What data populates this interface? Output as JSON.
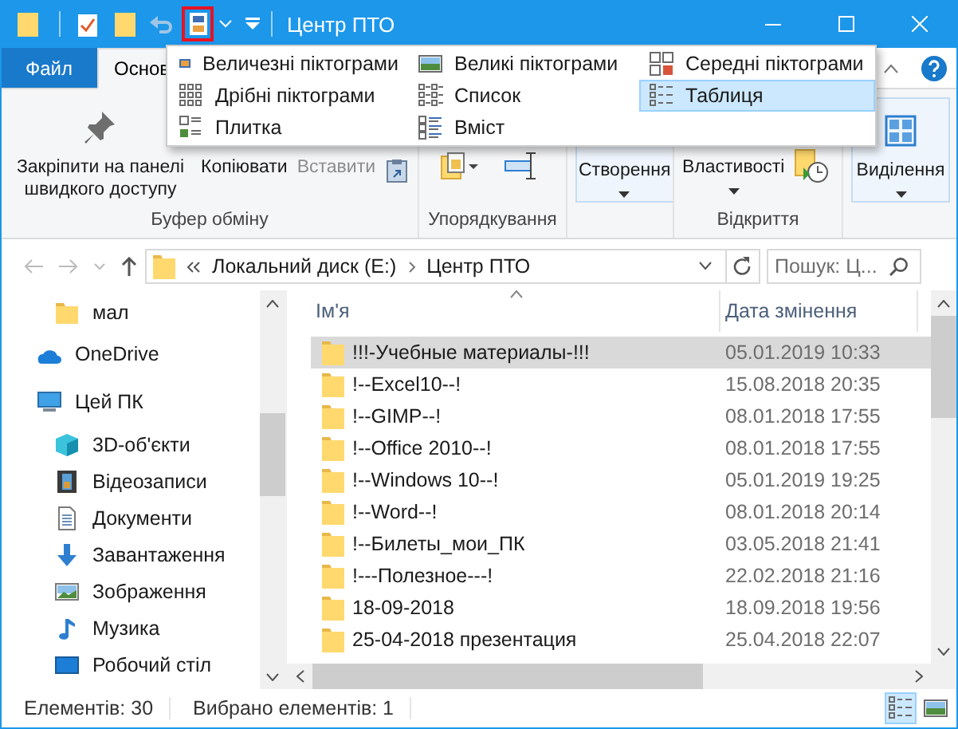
{
  "window": {
    "title": "Центр ПТО"
  },
  "quick_access": [
    {
      "kind": "folder"
    },
    {
      "kind": "properties"
    },
    {
      "kind": "new-folder"
    },
    {
      "kind": "undo",
      "disabled": true
    },
    {
      "kind": "view",
      "highlighted": true
    }
  ],
  "ribbon": {
    "tabs": [
      {
        "label": "Файл",
        "kind": "file",
        "selected": false
      },
      {
        "label": "Основ",
        "kind": "tab",
        "selected": true
      }
    ],
    "groups": [
      {
        "label": "Буфер обміну",
        "buttons": [
          {
            "label": "Закріпити на панелі швидкого доступу",
            "kind": "pin"
          },
          {
            "label": "Копіювати",
            "kind": "copy"
          },
          {
            "label": "Вставити",
            "kind": "paste",
            "disabled": true
          },
          {
            "kind": "paste-shortcut"
          }
        ]
      },
      {
        "label": "Упорядкування",
        "buttons": [
          {
            "kind": "move-to"
          },
          {
            "kind": "rename"
          }
        ]
      },
      {
        "buttons": [
          {
            "label": "Створення",
            "kind": "collapsed"
          }
        ]
      },
      {
        "label": "Відкриття",
        "buttons": [
          {
            "label": "Властивості",
            "kind": "properties"
          },
          {
            "kind": "history"
          }
        ]
      },
      {
        "buttons": [
          {
            "label": "Виділення",
            "kind": "select"
          }
        ]
      }
    ]
  },
  "layout_menu": {
    "items": [
      {
        "label": "Величезні піктограми",
        "kind": "extra-large",
        "selected": false
      },
      {
        "label": "Великі піктограми",
        "kind": "large",
        "selected": false
      },
      {
        "label": "Середні піктограми",
        "kind": "medium",
        "selected": false
      },
      {
        "label": "Дрібні піктограми",
        "kind": "small",
        "selected": false
      },
      {
        "label": "Список",
        "kind": "list",
        "selected": false
      },
      {
        "label": "Таблиця",
        "kind": "details",
        "selected": true
      },
      {
        "label": "Плитка",
        "kind": "tiles",
        "selected": false
      },
      {
        "label": "Вміст",
        "kind": "content",
        "selected": false
      }
    ]
  },
  "address_bar": {
    "crumbs": [
      "Локальний диск (E:)",
      "Центр ПТО"
    ]
  },
  "search": {
    "placeholder": "Пошук: Ц..."
  },
  "nav_pane": {
    "partial_items": [
      {
        "label": "мал",
        "kind": "folder"
      }
    ],
    "items": [
      {
        "label": "OneDrive",
        "kind": "cloud"
      },
      {
        "label": "Цей ПК",
        "kind": "pc",
        "children": [
          {
            "label": "3D-об'єкти",
            "kind": "cube"
          },
          {
            "label": "Відеозаписи",
            "kind": "film"
          },
          {
            "label": "Документи",
            "kind": "document"
          },
          {
            "label": "Завантаження",
            "kind": "download"
          },
          {
            "label": "Зображення",
            "kind": "image"
          },
          {
            "label": "Музика",
            "kind": "music"
          },
          {
            "label": "Робочий стіл",
            "kind": "desktop"
          }
        ]
      }
    ]
  },
  "table": {
    "columns": [
      "Ім'я",
      "Дата змінення"
    ],
    "rows": [
      {
        "name": "!!!-Учебные материалы-!!!",
        "date": "05.01.2019 10:33",
        "selected": true
      },
      {
        "name": "!--Excel10--!",
        "date": "15.08.2018 20:35",
        "selected": false
      },
      {
        "name": "!--GIMP--!",
        "date": "08.01.2018 17:55",
        "selected": false
      },
      {
        "name": "!--Office 2010--!",
        "date": "08.01.2018 17:55",
        "selected": false
      },
      {
        "name": "!--Windows 10--!",
        "date": "05.01.2019 19:25",
        "selected": false
      },
      {
        "name": "!--Word--!",
        "date": "08.01.2018 20:14",
        "selected": false
      },
      {
        "name": "!--Билеты_мои_ПК",
        "date": "03.05.2018 21:41",
        "selected": false
      },
      {
        "name": "!---Полезное---!",
        "date": "22.02.2018 21:16",
        "selected": false
      },
      {
        "name": "18-09-2018",
        "date": "18.09.2018 19:56",
        "selected": false
      },
      {
        "name": "25-04-2018 презентация",
        "date": "25.04.2018 22:07",
        "selected": false
      }
    ]
  },
  "status_bar": {
    "items": [
      "Елементів: 30",
      "Вибрано елементів: 1"
    ],
    "views": [
      {
        "kind": "details",
        "selected": true
      },
      {
        "kind": "large",
        "selected": false
      }
    ]
  }
}
